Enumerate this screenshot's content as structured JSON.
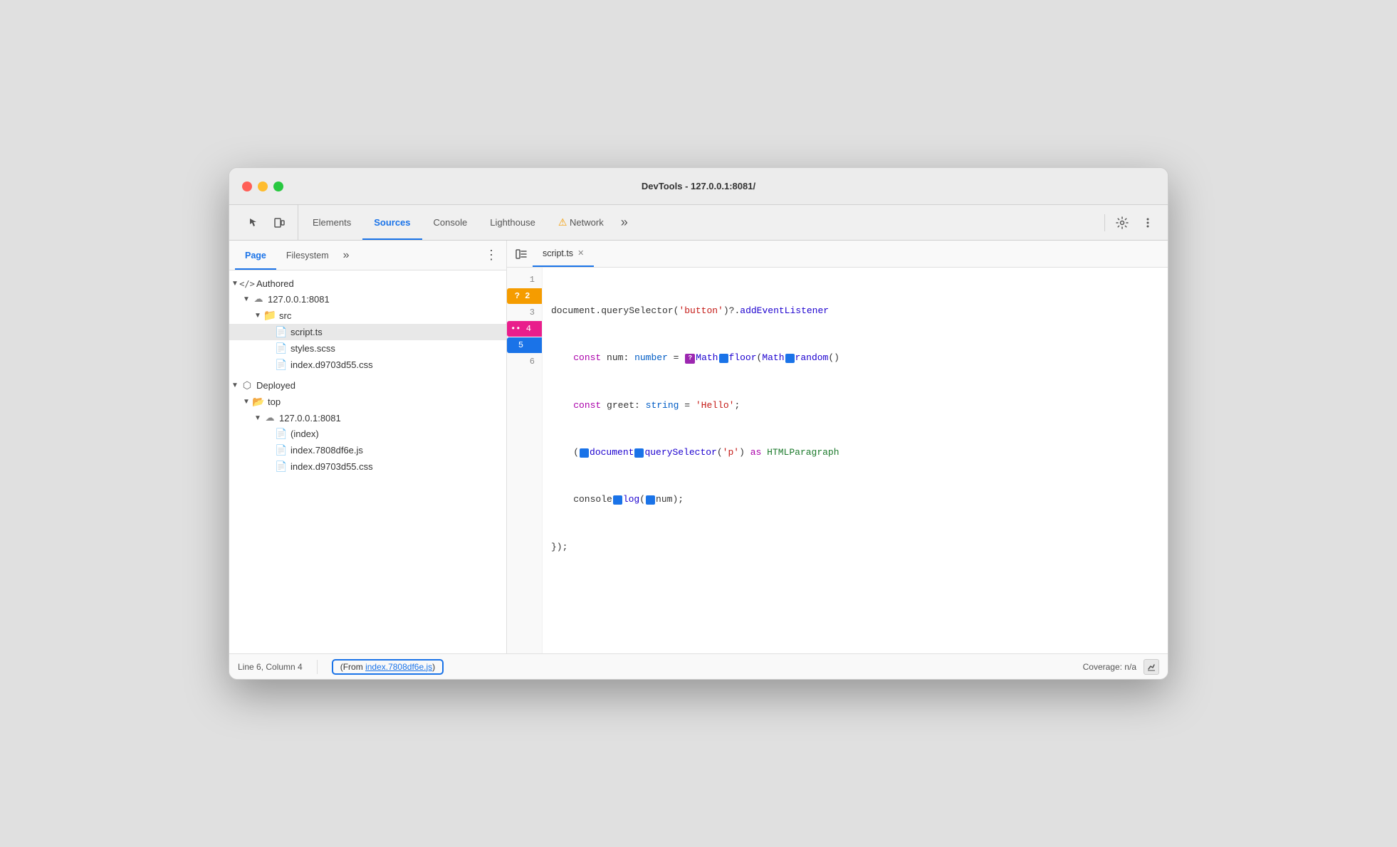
{
  "window": {
    "title": "DevTools - 127.0.0.1:8081/"
  },
  "tabbar": {
    "tabs": [
      {
        "id": "elements",
        "label": "Elements",
        "active": false
      },
      {
        "id": "sources",
        "label": "Sources",
        "active": true
      },
      {
        "id": "console",
        "label": "Console",
        "active": false
      },
      {
        "id": "lighthouse",
        "label": "Lighthouse",
        "active": false
      },
      {
        "id": "network",
        "label": "Network",
        "active": false
      }
    ],
    "more_label": "»"
  },
  "subtabs": {
    "tabs": [
      {
        "id": "page",
        "label": "Page",
        "active": true
      },
      {
        "id": "filesystem",
        "label": "Filesystem",
        "active": false
      }
    ],
    "more_label": "»"
  },
  "filetree": {
    "sections": [
      {
        "id": "authored",
        "label": "Authored",
        "icon": "code-icon",
        "expanded": true,
        "children": [
          {
            "id": "authored-server",
            "label": "127.0.0.1:8081",
            "icon": "cloud-icon",
            "expanded": true,
            "indent": 1,
            "children": [
              {
                "id": "src-folder",
                "label": "src",
                "icon": "folder-icon",
                "iconColor": "orange",
                "expanded": true,
                "indent": 2,
                "children": [
                  {
                    "id": "script-ts",
                    "label": "script.ts",
                    "icon": "file-ts-icon",
                    "indent": 3,
                    "selected": true
                  },
                  {
                    "id": "styles-scss",
                    "label": "styles.scss",
                    "icon": "file-scss-icon",
                    "indent": 3
                  },
                  {
                    "id": "index-css",
                    "label": "index.d9703d55.css",
                    "icon": "file-css-icon",
                    "indent": 3
                  }
                ]
              }
            ]
          }
        ]
      },
      {
        "id": "deployed",
        "label": "Deployed",
        "icon": "cube-icon",
        "expanded": true,
        "children": [
          {
            "id": "deployed-top",
            "label": "top",
            "icon": "folder-white-icon",
            "expanded": true,
            "indent": 1,
            "children": [
              {
                "id": "deployed-server",
                "label": "127.0.0.1:8081",
                "icon": "cloud-icon",
                "expanded": true,
                "indent": 2,
                "children": [
                  {
                    "id": "index-html",
                    "label": "(index)",
                    "icon": "file-gray-icon",
                    "indent": 3
                  },
                  {
                    "id": "index-js",
                    "label": "index.7808df6e.js",
                    "icon": "file-js-icon",
                    "indent": 3
                  },
                  {
                    "id": "index-deployed-css",
                    "label": "index.d9703d55.css",
                    "icon": "file-css-icon",
                    "indent": 3
                  }
                ]
              }
            ]
          }
        ]
      }
    ]
  },
  "editor": {
    "tab_label": "script.ts",
    "lines": [
      {
        "num": 1,
        "content": "document.querySelector('button')?.addEventListener"
      },
      {
        "num": 2,
        "type": "breakpoint-question",
        "badge": "?",
        "content": "    const num: number = Math.floor(Math.random()"
      },
      {
        "num": 3,
        "content": "    const greet: string = 'Hello';"
      },
      {
        "num": 4,
        "type": "breakpoint-dots",
        "badge": "••",
        "content": "    (document.querySelector('p') as HTMLParagraph"
      },
      {
        "num": 5,
        "type": "breakpoint-current",
        "content": "    console.log(num);"
      },
      {
        "num": 6,
        "content": "});"
      }
    ]
  },
  "statusbar": {
    "position": "Line 6, Column 4",
    "source_label": "From ",
    "source_link": "index.7808df6e.js",
    "source_suffix": ")",
    "source_prefix": "(",
    "coverage_label": "Coverage: n/a"
  }
}
